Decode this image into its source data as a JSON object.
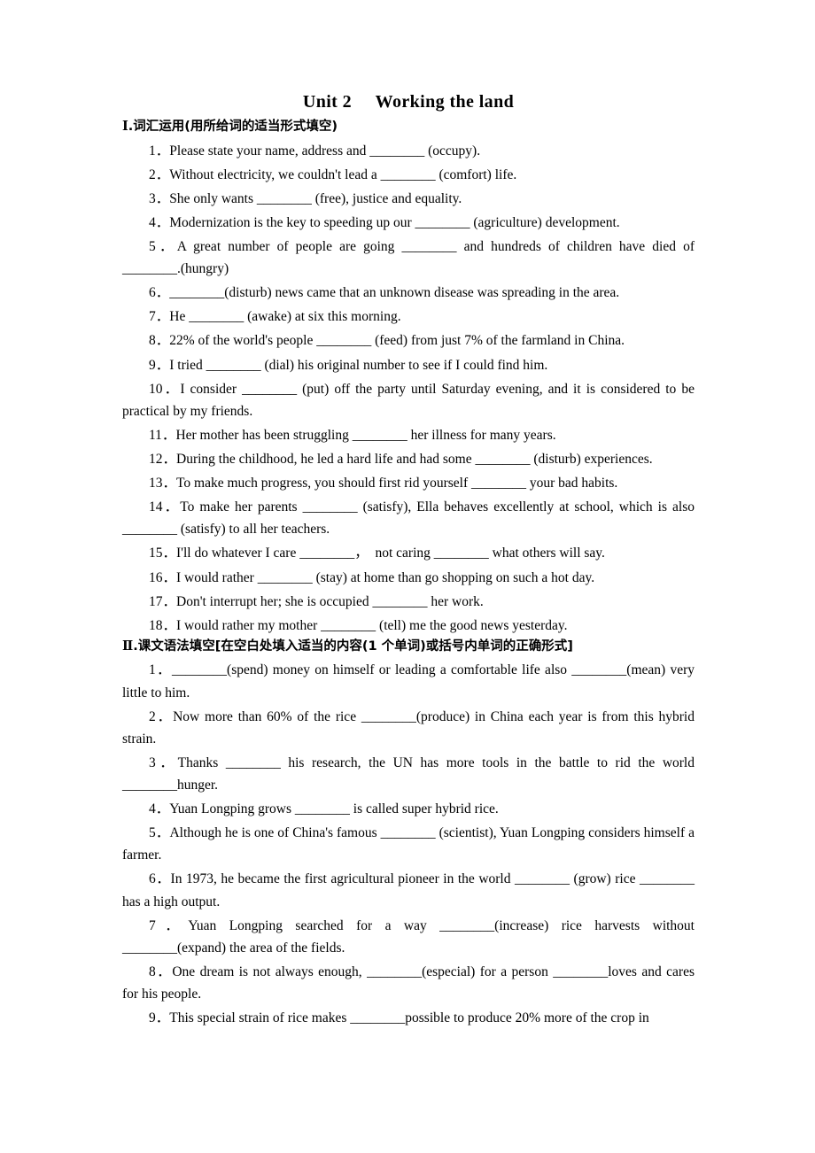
{
  "title": "Unit 2     Working the land",
  "section1": {
    "heading_numeral": "Ⅰ",
    "heading_text": ".词汇运用(用所给词的适当形式填空)",
    "items": [
      {
        "num": "1．",
        "text": "Please state your name, address and ________ (occupy)."
      },
      {
        "num": "2．",
        "text": "Without electricity, we couldn't lead a ________ (comfort) life."
      },
      {
        "num": "3．",
        "text": "She only wants ________ (free), justice and equality."
      },
      {
        "num": "4．",
        "text": "Modernization is the key to speeding up our ________ (agriculture) development."
      },
      {
        "num": "5．",
        "text": "A great number of people are going ________ and hundreds of children have died of ________.(hungry)"
      },
      {
        "num": "6．",
        "text": "________(disturb) news came that an unknown disease was spreading in the area."
      },
      {
        "num": "7．",
        "text": "He ________ (awake) at six this morning."
      },
      {
        "num": "8．",
        "text": "22% of the world's people ________ (feed) from just 7% of the farmland in China."
      },
      {
        "num": "9．",
        "text": "I tried ________ (dial) his original number to see if I could find him."
      },
      {
        "num": "10．",
        "text": "I consider ________ (put) off the party until Saturday evening, and it is considered to be practical by my friends."
      },
      {
        "num": "11．",
        "text": "Her mother has been struggling ________ her illness for many years."
      },
      {
        "num": "12．",
        "text": "During the childhood, he led a hard life and had some ________ (disturb) experiences."
      },
      {
        "num": "13．",
        "text": "To make much progress, you should first rid yourself ________ your bad habits."
      },
      {
        "num": "14．",
        "text": "To make her parents ________ (satisfy), Ella behaves excellently at school, which is also ________ (satisfy) to all her teachers."
      },
      {
        "num": "15．",
        "text": "I'll do whatever I care ________，  not caring ________ what others will say."
      },
      {
        "num": "16．",
        "text": "I would rather ________ (stay) at home than go shopping on such a hot day."
      },
      {
        "num": "17．",
        "text": "Don't interrupt her; she is occupied ________ her work."
      },
      {
        "num": "18．",
        "text": "I would rather my mother ________ (tell) me the good news yesterday."
      }
    ]
  },
  "section2": {
    "heading_numeral": "Ⅱ",
    "heading_text": ".课文语法填空[在空白处填入适当的内容(1 个单词)或括号内单词的正确形式]",
    "items": [
      {
        "num": "1．",
        "text": "________(spend) money on himself or leading a comfortable life also ________(mean) very little to him."
      },
      {
        "num": "2．",
        "text": "Now more than 60% of the rice ________(produce) in China each year is from this hybrid strain."
      },
      {
        "num": "3．",
        "text": "Thanks ________ his research, the UN has more tools in the battle to rid the world ________hunger."
      },
      {
        "num": "4．",
        "text": "Yuan Longping grows ________ is called super hybrid rice."
      },
      {
        "num": "5．",
        "text": "Although he is one of China's famous ________ (scientist), Yuan Longping considers himself a farmer."
      },
      {
        "num": "6．",
        "text": "In 1973, he became the first agricultural pioneer in the world ________ (grow) rice ________ has a high output."
      },
      {
        "num": "7．",
        "text": "Yuan Longping searched for a way ________(increase) rice harvests without ________(expand) the area of the fields."
      },
      {
        "num": "8．",
        "text": "One dream is not always enough, ________(especial) for a person ________loves and cares for his people."
      },
      {
        "num": "9．",
        "text": "This special strain of rice makes ________possible to produce 20% more of the crop in"
      }
    ]
  }
}
